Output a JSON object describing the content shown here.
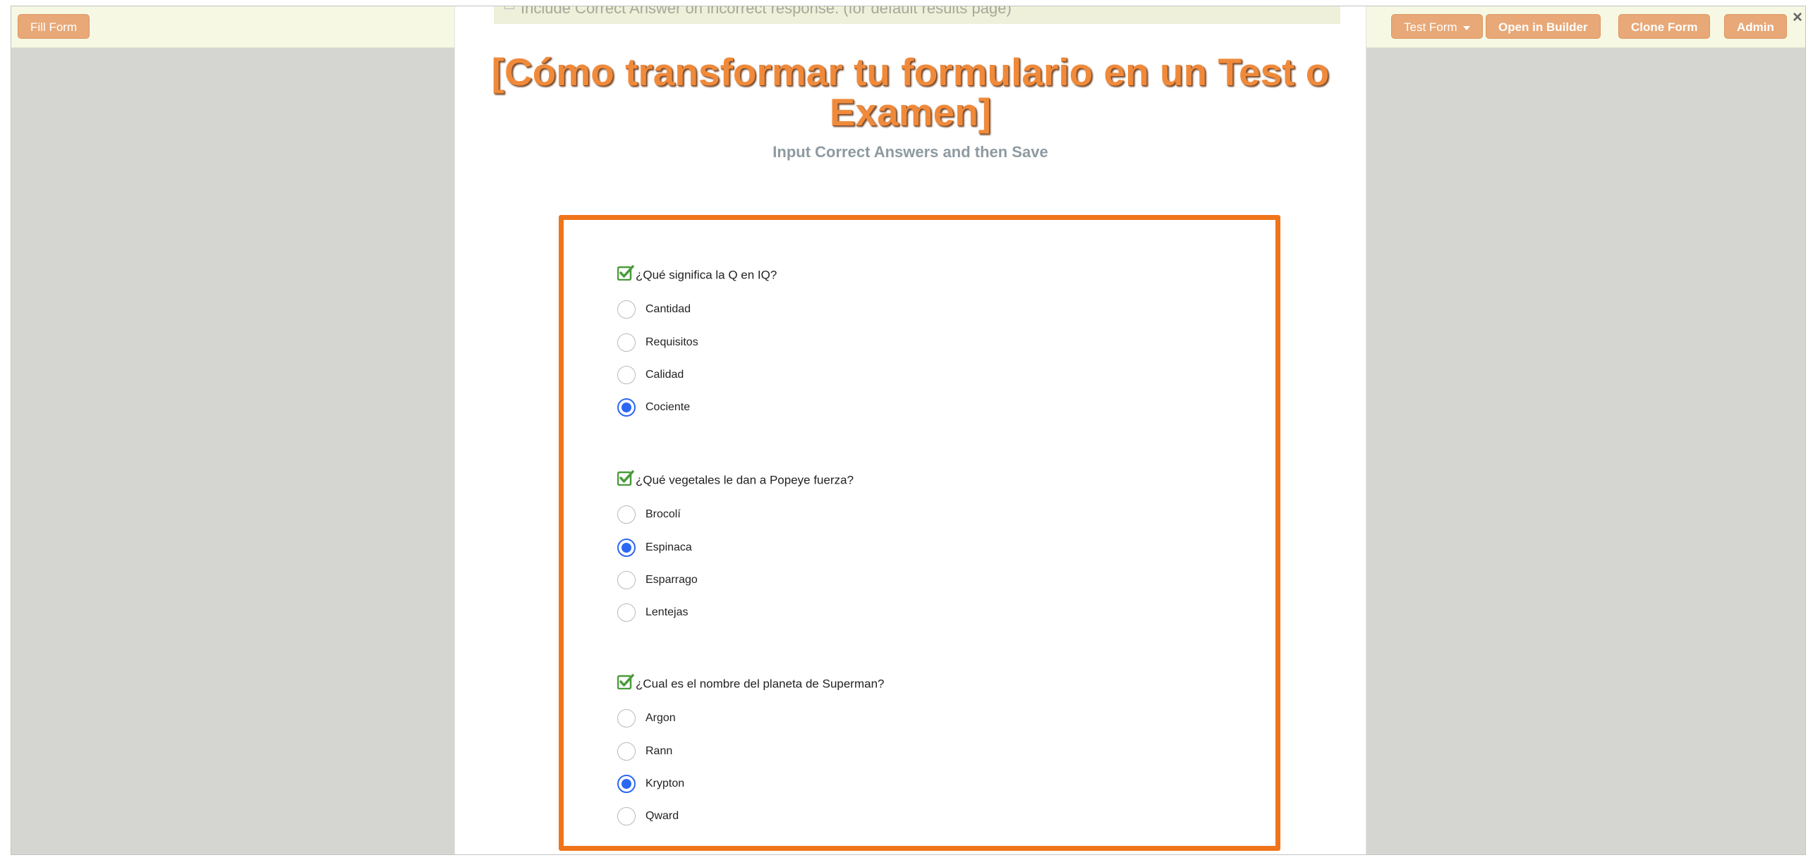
{
  "toolbar": {
    "fill_form": "Fill Form",
    "test_form": "Test Form",
    "open_in_builder": "Open in Builder",
    "clone_form": "Clone Form",
    "admin": "Admin",
    "close": "×"
  },
  "settings": {
    "include_correct_answer_label": "Include Correct Answer on incorrect response. (for default results page)"
  },
  "form": {
    "title": "[Cómo transformar tu formulario en un Test o Examen]",
    "subtitle": "Input Correct Answers and then Save"
  },
  "questions": [
    {
      "text": "¿Qué significa la Q en IQ?",
      "options": [
        {
          "label": "Cantidad",
          "selected": false
        },
        {
          "label": "Requisitos",
          "selected": false
        },
        {
          "label": "Calidad",
          "selected": false
        },
        {
          "label": "Cociente",
          "selected": true
        }
      ]
    },
    {
      "text": "¿Qué vegetales le dan a Popeye fuerza?",
      "options": [
        {
          "label": "Brocolí",
          "selected": false
        },
        {
          "label": "Espinaca",
          "selected": true
        },
        {
          "label": "Esparrago",
          "selected": false
        },
        {
          "label": "Lentejas",
          "selected": false
        }
      ]
    },
    {
      "text": "¿Cual es el nombre del planeta de Superman?",
      "options": [
        {
          "label": "Argon",
          "selected": false
        },
        {
          "label": "Rann",
          "selected": false
        },
        {
          "label": "Krypton",
          "selected": true
        },
        {
          "label": "Qward",
          "selected": false
        }
      ]
    }
  ],
  "colors": {
    "accent": "#f07419",
    "button": "#e8a877",
    "radio_selected": "#2c67f2",
    "check_green": "#4a9a3b"
  }
}
